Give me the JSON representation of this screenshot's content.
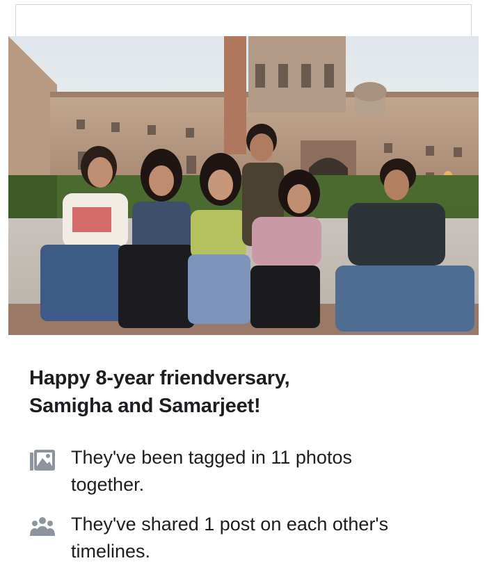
{
  "memory": {
    "title_line1": "Happy 8-year friendversary,",
    "title_line2": "Samigha and Samarjeet!",
    "facts": [
      {
        "icon": "photos-icon",
        "text_line1": "They've been tagged in 11 photos",
        "text_line2": "together."
      },
      {
        "icon": "people-icon",
        "text_line1": "They've shared 1 post on each other's",
        "text_line2": "timelines."
      }
    ]
  },
  "colors": {
    "text": "#1c1e21",
    "icon": "#8d949e",
    "card_border": "#d3d3d3"
  }
}
